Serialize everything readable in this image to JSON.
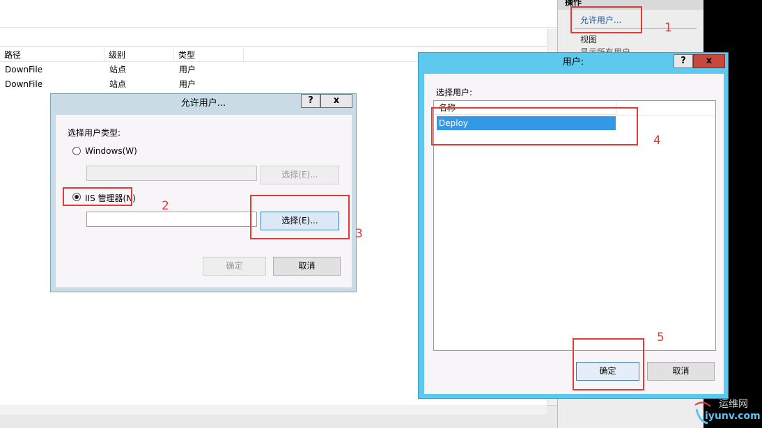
{
  "background": {
    "table": {
      "columns": [
        "路径",
        "级别",
        "类型"
      ],
      "rows": [
        [
          "DownFile",
          "站点",
          "用户"
        ],
        [
          "DownFile",
          "站点",
          "用户"
        ]
      ]
    }
  },
  "actions_pane": {
    "header": "操作",
    "items": [
      "允许用户...",
      "视图",
      "显示所有用户"
    ]
  },
  "allow_dialog": {
    "title": "允许用户...",
    "help_btn": "?",
    "close_btn": "x",
    "section_label": "选择用户类型:",
    "windows_option": "Windows(W)",
    "windows_select_btn": "选择(E)...",
    "iis_option": "IIS 管理器(N)",
    "iis_select_btn": "选择(E)...",
    "ok_btn": "确定",
    "cancel_btn": "取消",
    "selected": "iis"
  },
  "users_dialog": {
    "title": "用户:",
    "help_btn": "?",
    "close_btn": "x",
    "list_label": "选择用户:",
    "column_header": "名称",
    "users": [
      "Deploy"
    ],
    "ok_btn": "确定",
    "cancel_btn": "取消"
  },
  "annotations": [
    "1",
    "2",
    "3",
    "4",
    "5"
  ],
  "watermark": {
    "line1": "运维网",
    "line2": "iyunv.com"
  },
  "colors": {
    "annotation_red": "#e53935",
    "selection_blue": "#3399e6",
    "dialog_title_blue": "#5ec9ee",
    "link_blue": "#1e5aa8"
  }
}
